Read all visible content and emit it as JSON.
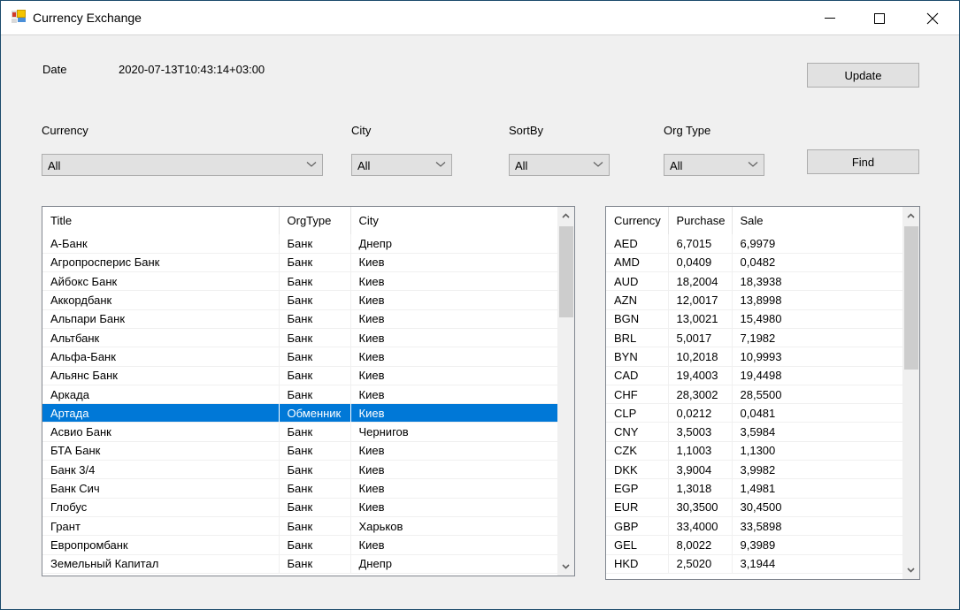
{
  "window": {
    "title": "Currency Exchange",
    "controls": {
      "minimize": "minimize",
      "maximize": "maximize",
      "close": "close"
    }
  },
  "header": {
    "date_label": "Date",
    "date_value": "2020-07-13T10:43:14+03:00",
    "update_label": "Update"
  },
  "filters": {
    "currency": {
      "label": "Currency",
      "selected": "All"
    },
    "city": {
      "label": "City",
      "selected": "All"
    },
    "sort_by": {
      "label": "SortBy",
      "selected": "All"
    },
    "org_type": {
      "label": "Org Type",
      "selected": "All"
    },
    "find_label": "Find"
  },
  "organizations": {
    "columns": [
      "Title",
      "OrgType",
      "City"
    ],
    "selected_index": 9,
    "rows": [
      [
        "А-Банк",
        "Банк",
        "Днепр"
      ],
      [
        "Агропросперис Банк",
        "Банк",
        "Киев"
      ],
      [
        "Айбокс Банк",
        "Банк",
        "Киев"
      ],
      [
        "Аккордбанк",
        "Банк",
        "Киев"
      ],
      [
        "Альпари Банк",
        "Банк",
        "Киев"
      ],
      [
        "Альтбанк",
        "Банк",
        "Киев"
      ],
      [
        "Альфа-Банк",
        "Банк",
        "Киев"
      ],
      [
        "Альянс Банк",
        "Банк",
        "Киев"
      ],
      [
        "Аркада",
        "Банк",
        "Киев"
      ],
      [
        "Артада",
        "Обменник",
        "Киев"
      ],
      [
        "Асвио Банк",
        "Банк",
        "Чернигов"
      ],
      [
        "БТА Банк",
        "Банк",
        "Киев"
      ],
      [
        "Банк 3/4",
        "Банк",
        "Киев"
      ],
      [
        "Банк Сич",
        "Банк",
        "Киев"
      ],
      [
        "Глобус",
        "Банк",
        "Киев"
      ],
      [
        "Грант",
        "Банк",
        "Харьков"
      ],
      [
        "Европромбанк",
        "Банк",
        "Киев"
      ],
      [
        "Земельный Капитал",
        "Банк",
        "Днепр"
      ]
    ],
    "scroll_position": 0.0
  },
  "rates": {
    "columns": [
      "Currency",
      "Purchase",
      "Sale"
    ],
    "rows": [
      [
        "AED",
        "6,7015",
        "6,9979"
      ],
      [
        "AMD",
        "0,0409",
        "0,0482"
      ],
      [
        "AUD",
        "18,2004",
        "18,3938"
      ],
      [
        "AZN",
        "12,0017",
        "13,8998"
      ],
      [
        "BGN",
        "13,0021",
        "15,4980"
      ],
      [
        "BRL",
        "5,0017",
        "7,1982"
      ],
      [
        "BYN",
        "10,2018",
        "10,9993"
      ],
      [
        "CAD",
        "19,4003",
        "19,4498"
      ],
      [
        "CHF",
        "28,3002",
        "28,5500"
      ],
      [
        "CLP",
        "0,0212",
        "0,0481"
      ],
      [
        "CNY",
        "3,5003",
        "3,5984"
      ],
      [
        "CZK",
        "1,1003",
        "1,1300"
      ],
      [
        "DKK",
        "3,9004",
        "3,9982"
      ],
      [
        "EGP",
        "1,3018",
        "1,4981"
      ],
      [
        "EUR",
        "30,3500",
        "30,4500"
      ],
      [
        "GBP",
        "33,4000",
        "33,5898"
      ],
      [
        "GEL",
        "8,0022",
        "9,3989"
      ],
      [
        "HKD",
        "2,5020",
        "3,1944"
      ]
    ],
    "scroll_position": 0.0
  },
  "colors": {
    "selection": "#0078d7",
    "window_bg": "#f0f0f0",
    "button_bg": "#e1e1e1"
  }
}
